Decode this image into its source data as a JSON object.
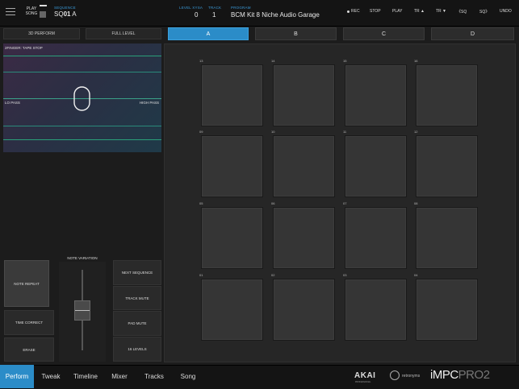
{
  "topbar": {
    "play_song_line1": "PLAY",
    "play_song_line2": "SONG",
    "sequence_label": "SEQUENCE",
    "sequence_prefix": "SQ",
    "sequence_number": "01",
    "sequence_letter": "A",
    "count_label": "LEVEL XYSA",
    "count_value": "0",
    "track_label": "TRACK",
    "track_value": "1",
    "program_label": "PROGRAM",
    "program_value": "BCM Kit 8 Niche Audio Garage",
    "rec": "REC",
    "stop": "STOP",
    "play": "PLAY",
    "tr_up": "TR ▲",
    "tr_down": "TR ▼",
    "sq_prev": "《SQ",
    "sq_next": "SQ》",
    "undo": "UNDO"
  },
  "scene": {
    "perform_3d": "3D PERFORM",
    "full_level": "FULL LEVEL"
  },
  "banks": [
    "A",
    "B",
    "C",
    "D"
  ],
  "xypad": {
    "title": "2FINGER: TAPE STOP",
    "left": "LO PASS",
    "right": "HIGH PASS"
  },
  "pads": [
    [
      "13",
      "14",
      "15",
      "16"
    ],
    [
      "09",
      "10",
      "11",
      "12"
    ],
    [
      "05",
      "06",
      "07",
      "08"
    ],
    [
      "01",
      "02",
      "03",
      "04"
    ]
  ],
  "controls": {
    "note_repeat": "NOTE REPEAT",
    "time_correct": "TIME CORRECT",
    "erase": "ERASE",
    "note_variation": "NOTE VARIATION",
    "next_sequence": "NEXT SEQUENCE",
    "track_mute": "TRACK MUTE",
    "pad_mute": "PAD MUTE",
    "levels_16": "16 LEVELS"
  },
  "tabs": [
    "Perform",
    "Tweak",
    "Timeline",
    "Mixer",
    "Tracks",
    "Song"
  ],
  "brand": {
    "akai": "AKAI",
    "akai_sub": "PROFESSIONAL",
    "partner": "retronyms",
    "app_main": "iMPC",
    "app_pro": "PRO",
    "app_ver": "2"
  },
  "colors": {
    "accent": "#2b8cc8",
    "label_blue": "#3a9ad9"
  }
}
